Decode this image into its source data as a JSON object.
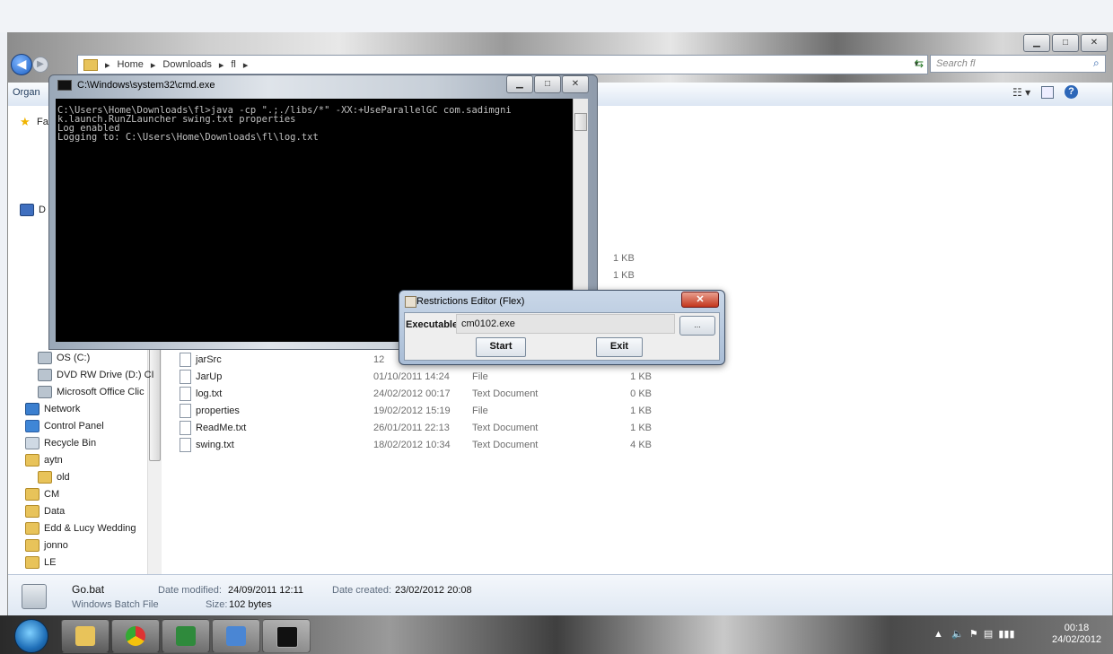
{
  "explorer": {
    "breadcrumb": [
      "Home",
      "Downloads",
      "fl"
    ],
    "search_placeholder": "Search fl",
    "toolbar_organize": "Organ",
    "nav_items": [
      {
        "label": "Fa",
        "icon": "star-icon",
        "type": "star"
      },
      {
        "label": "D",
        "icon": "computer-icon",
        "type": "comp"
      },
      {
        "label": "OS (C:)",
        "icon": "drive-icon",
        "type": "drive"
      },
      {
        "label": "DVD RW Drive (D:) CI",
        "icon": "dvd-drive-icon",
        "type": "drive"
      },
      {
        "label": "Microsoft Office Clic",
        "icon": "drive-icon",
        "type": "drive"
      },
      {
        "label": "Network",
        "icon": "network-icon",
        "type": "net"
      },
      {
        "label": "Control Panel",
        "icon": "control-panel-icon",
        "type": "cp"
      },
      {
        "label": "Recycle Bin",
        "icon": "recycle-bin-icon",
        "type": "bin"
      },
      {
        "label": "aytn",
        "icon": "folder-icon",
        "type": "folder"
      },
      {
        "label": "old",
        "icon": "folder-icon",
        "type": "folder"
      },
      {
        "label": "CM",
        "icon": "folder-icon",
        "type": "folder"
      },
      {
        "label": "Data",
        "icon": "folder-icon",
        "type": "folder"
      },
      {
        "label": "Edd & Lucy Wedding",
        "icon": "folder-icon",
        "type": "folder"
      },
      {
        "label": "jonno",
        "icon": "folder-icon",
        "type": "folder"
      },
      {
        "label": "LE",
        "icon": "folder-icon",
        "type": "folder"
      }
    ],
    "files": [
      {
        "name": "jarSrc",
        "date": "12",
        "type": "",
        "size": ""
      },
      {
        "name": "JarUp",
        "date": "01/10/2011 14:24",
        "type": "File",
        "size": "1 KB"
      },
      {
        "name": "log.txt",
        "date": "24/02/2012 00:17",
        "type": "Text Document",
        "size": "0 KB"
      },
      {
        "name": "properties",
        "date": "19/02/2012 15:19",
        "type": "File",
        "size": "1 KB"
      },
      {
        "name": "ReadMe.txt",
        "date": "26/01/2011 22:13",
        "type": "Text Document",
        "size": "1 KB"
      },
      {
        "name": "swing.txt",
        "date": "18/02/2012 10:34",
        "type": "Text Document",
        "size": "4 KB"
      }
    ],
    "partial_sizes": [
      "1 KB",
      "1 KB"
    ],
    "details": {
      "filename": "Go.bat",
      "filetype": "Windows Batch File",
      "modified_label": "Date modified:",
      "modified_value": "24/09/2011 12:11",
      "created_label": "Date created:",
      "created_value": "23/02/2012 20:08",
      "size_label": "Size:",
      "size_value": "102 bytes"
    }
  },
  "cmd": {
    "title": "C:\\Windows\\system32\\cmd.exe",
    "output": "C:\\Users\\Home\\Downloads\\fl>java -cp \".;./libs/*\" -XX:+UseParallelGC com.sadimgni\nk.launch.RunZLauncher swing.txt properties\nLog enabled\nLogging to: C:\\Users\\Home\\Downloads\\fl\\log.txt"
  },
  "dialog": {
    "title": "Restrictions Editor (Flex)",
    "executable_label": "Executable",
    "executable_value": "cm0102.exe",
    "browse_label": "...",
    "start_label": "Start",
    "exit_label": "Exit"
  },
  "taskbar": {
    "clock_time": "00:18",
    "clock_date": "24/02/2012"
  }
}
